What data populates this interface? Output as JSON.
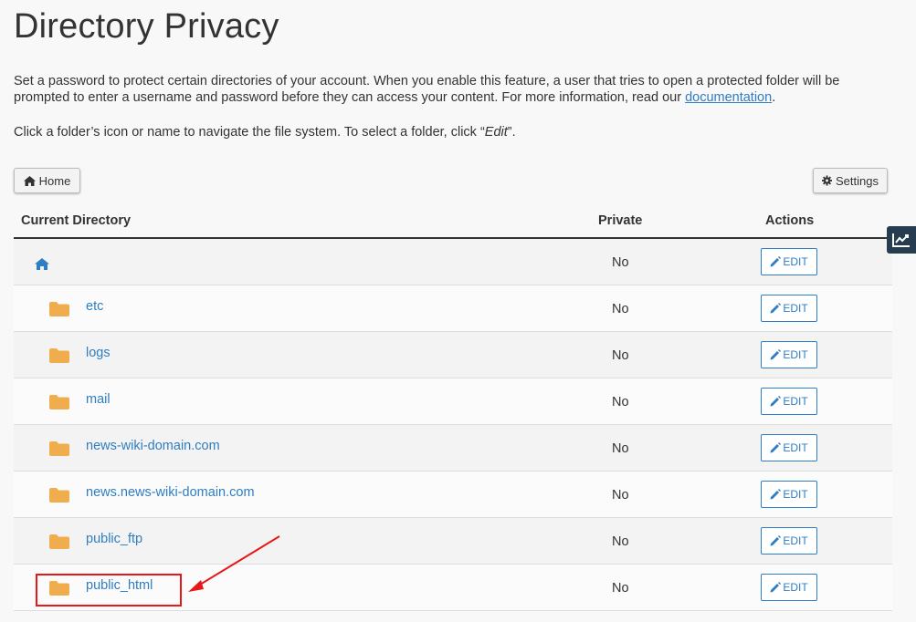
{
  "page": {
    "title": "Directory Privacy",
    "description_part1": "Set a password to protect certain directories of your account. When you enable this feature, a user that tries to open a protected folder will be prompted to enter a username and password before they can access your content. For more information, read our ",
    "documentation_link": "documentation",
    "description_part2": ".",
    "hint_part1": "Click a folder’s icon or name to navigate the file system. To select a folder, click “",
    "hint_edit": "Edit",
    "hint_part2": "”."
  },
  "toolbar": {
    "home_label": "Home",
    "settings_label": "Settings"
  },
  "table": {
    "headers": {
      "directory": "Current Directory",
      "private": "Private",
      "actions": "Actions"
    },
    "edit_label": "EDIT",
    "rows": [
      {
        "name": "",
        "type": "home",
        "private": "No"
      },
      {
        "name": "etc",
        "type": "folder",
        "private": "No"
      },
      {
        "name": "logs",
        "type": "folder",
        "private": "No"
      },
      {
        "name": "mail",
        "type": "folder",
        "private": "No"
      },
      {
        "name": "news-wiki-domain.com",
        "type": "folder",
        "private": "No"
      },
      {
        "name": "news.news-wiki-domain.com",
        "type": "folder",
        "private": "No"
      },
      {
        "name": "public_ftp",
        "type": "folder",
        "private": "No"
      },
      {
        "name": "public_html",
        "type": "folder",
        "private": "No"
      }
    ]
  },
  "colors": {
    "link": "#2f7dc2",
    "folder": "#f0ad4e",
    "annotation": "#e81818",
    "side_tab": "#283c50"
  },
  "icons": [
    "home-icon",
    "gear-icon",
    "folder-icon",
    "pencil-icon",
    "chart-line-icon"
  ]
}
